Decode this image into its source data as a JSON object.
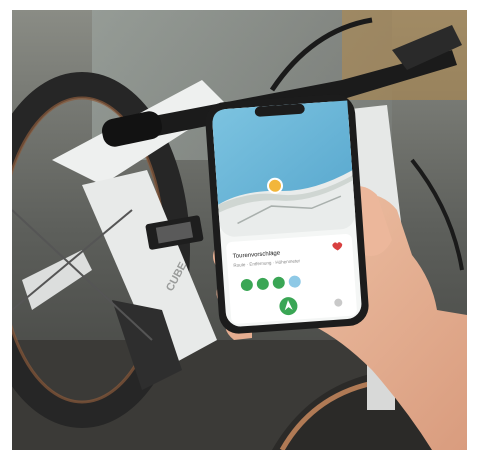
{
  "scene": {
    "background_color": "#ffffff",
    "accent_green": "#3aa655",
    "map_water": "#6fb8d9",
    "map_land": "#e9eceb",
    "frame_white": "#eef0ef"
  },
  "phone_screen": {
    "location_title": "Tourenvorschläge",
    "location_subtitle": "Route · Entfernung · Höhenmeter",
    "heart_icon": "heart-icon",
    "pin_icon": "location-pin-icon",
    "nav_icon": "navigation-arrow-icon"
  },
  "bike": {
    "frame_brand_text": "CUBE"
  }
}
